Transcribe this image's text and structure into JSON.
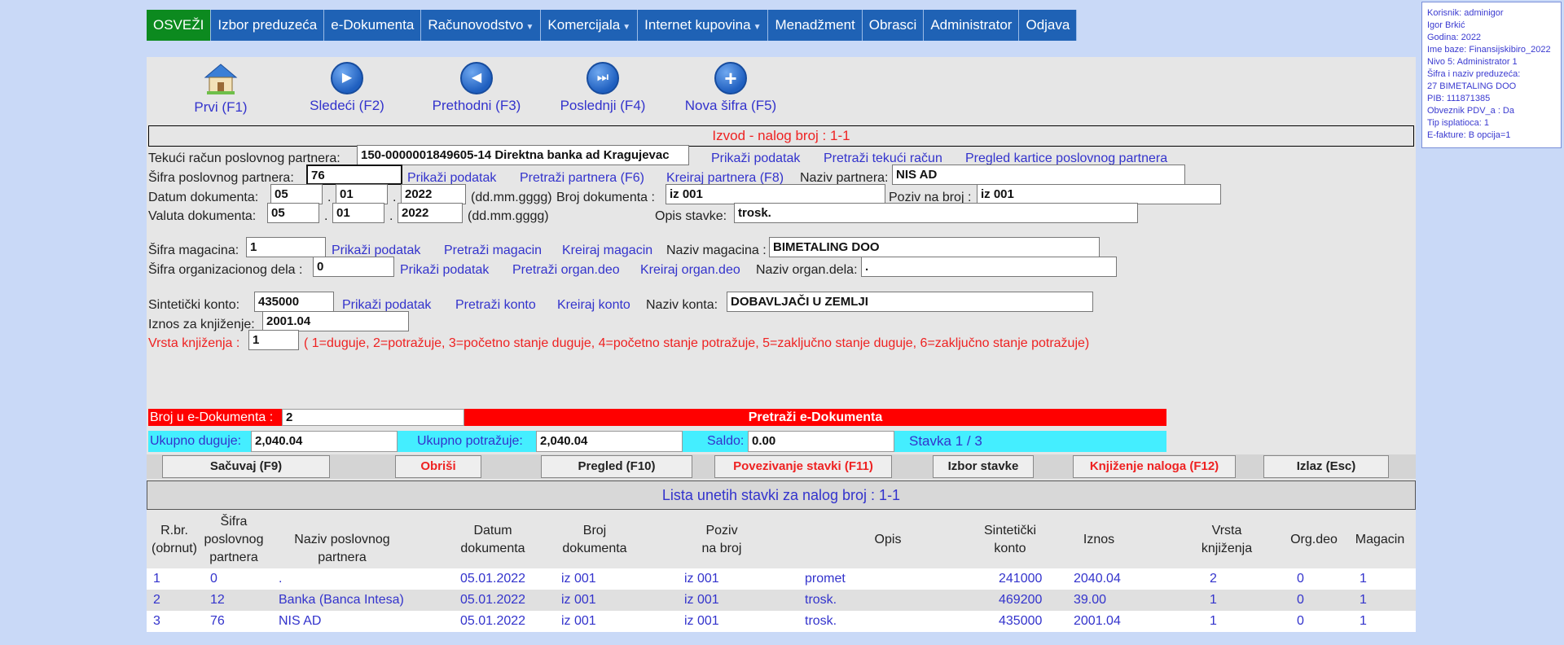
{
  "nav": {
    "items": [
      "OSVEŽI",
      "Izbor preduzeća",
      "e-Dokumenta",
      "Računovodstvo",
      "Komercijala",
      "Internet kupovina",
      "Menadžment",
      "Obrasci",
      "Administrator",
      "Odjava"
    ]
  },
  "info": {
    "lines": [
      "Korisnik: adminigor",
      "Igor Brkić",
      "Godina: 2022",
      "Ime baze: Finansijskibiro_2022",
      "Nivo 5: Administrator 1",
      "Šifra i naziv preduzeća:",
      "27 BIMETALING DOO",
      "PIB: 111871385",
      "Obveznik PDV_a : Da",
      "Tip isplatioca: 1",
      "E-fakture: B opcija=1"
    ]
  },
  "toolbar": {
    "first": "Prvi (F1)",
    "next": "Sledeći (F2)",
    "prev": "Prethodni (F3)",
    "last": "Poslednji (F4)",
    "new": "Nova šifra (F5)"
  },
  "form": {
    "title": "Izvod - nalog broj : 1-1",
    "tekuci_label": "Tekući račun poslovnog partnera:",
    "tekuci_value": "150-0000001849605-14 Direktna banka ad Kragujevac",
    "prikazi": "Prikaži podatak",
    "pretrazi_racun": "Pretraži tekući račun",
    "pregled_kartice": "Pregled kartice poslovnog partnera",
    "sifra_partnera_label": "Šifra poslovnog partnera:",
    "sifra_partnera_value": "76",
    "pretrazi_partnera": "Pretraži partnera (F6)",
    "kreiraj_partnera": "Kreiraj partnera (F8)",
    "naziv_partnera_label": "Naziv partnera:",
    "naziv_partnera_value": "NIS AD",
    "datum_label": "Datum dokumenta:",
    "datum_d": "05",
    "datum_m": "01",
    "datum_y": "2022",
    "dot": ".",
    "format": "(dd.mm.gggg)",
    "broj_label": "Broj dokumenta :",
    "broj_value": "iz 001",
    "poziv_label": "Poziv na broj :",
    "poziv_value": "iz 001",
    "valuta_label": "Valuta dokumenta:",
    "valuta_d": "05",
    "valuta_m": "01",
    "valuta_y": "2022",
    "opis_label": "Opis stavke:",
    "opis_value": "trosk.",
    "magacin_label": "Šifra magacina:",
    "magacin_value": "1",
    "pretrazi_magacin": "Pretraži magacin",
    "kreiraj_magacin": "Kreiraj magacin",
    "naziv_magacina_label": "Naziv magacina :",
    "naziv_magacina_value": "BIMETALING DOO",
    "org_label": "Šifra organizacionog dela :",
    "org_value": "0",
    "pretrazi_org": "Pretraži organ.deo",
    "kreiraj_org": "Kreiraj organ.deo",
    "naziv_org_label": "Naziv organ.dela:",
    "naziv_org_value": ".",
    "konto_label": "Sintetički konto:",
    "konto_value": "435000",
    "pretrazi_konto": "Pretraži konto",
    "kreiraj_konto": "Kreiraj konto",
    "naziv_konta_label": "Naziv konta:",
    "naziv_konta_value": "DOBAVLJAČI U ZEMLJI",
    "iznos_label": "Iznos za knjiženje:",
    "iznos_value": "2001.04",
    "vrsta_label": "Vrsta knjiženja :",
    "vrsta_value": "1",
    "vrsta_help": "( 1=duguje, 2=potražuje, 3=početno stanje duguje, 4=početno stanje potražuje, 5=zaključno stanje duguje, 6=zaključno stanje potražuje)"
  },
  "edok": {
    "broj_label": "Broj u e-Dokumenta :",
    "broj_value": "2",
    "search": "Pretraži e-Dokumenta"
  },
  "totals": {
    "duguje_label": "Ukupno duguje:",
    "duguje_value": "2,040.04",
    "potrazuje_label": "Ukupno potražuje:",
    "potrazuje_value": "2,040.04",
    "saldo_label": "Saldo:",
    "saldo_value": "0.00",
    "stavka": "Stavka 1 / 3"
  },
  "buttons": {
    "save": "Sačuvaj (F9)",
    "delete": "Obriši",
    "review": "Pregled (F10)",
    "link": "Povezivanje stavki (F11)",
    "select": "Izbor stavke",
    "post": "Knjiženje naloga (F12)",
    "exit": "Izlaz (Esc)"
  },
  "list": {
    "title": "Lista unetih stavki za nalog broj : 1-1",
    "headers": {
      "rbr": "R.br.\n(obrnut)",
      "sifra": "Šifra\nposlovnog\npartnera",
      "naziv": "Naziv poslovnog partnera",
      "datum": "Datum\ndokumenta",
      "broj": "Broj\ndokumenta",
      "poziv": "Poziv\nna broj",
      "opis": "Opis",
      "konto": "Sintetički\nkonto",
      "iznos": "Iznos",
      "vrsta": "Vrsta\nknjiženja",
      "org": "Org.deo",
      "magacin": "Magacin"
    },
    "rows": [
      {
        "rbr": "1",
        "sifra": "0",
        "naziv": ".",
        "datum": "05.01.2022",
        "broj": "iz 001",
        "poziv": "iz 001",
        "opis": "promet",
        "konto": "241000",
        "iznos": "2040.04",
        "vrsta": "2",
        "org": "0",
        "magacin": "1"
      },
      {
        "rbr": "2",
        "sifra": "12",
        "naziv": "Banka (Banca Intesa)",
        "datum": "05.01.2022",
        "broj": "iz 001",
        "poziv": "iz 001",
        "opis": "trosk.",
        "konto": "469200",
        "iznos": "39.00",
        "vrsta": "1",
        "org": "0",
        "magacin": "1"
      },
      {
        "rbr": "3",
        "sifra": "76",
        "naziv": "NIS AD",
        "datum": "05.01.2022",
        "broj": "iz 001",
        "poziv": "iz 001",
        "opis": "trosk.",
        "konto": "435000",
        "iznos": "2001.04",
        "vrsta": "1",
        "org": "0",
        "magacin": "1"
      }
    ]
  },
  "colors": {
    "nav_bg": "#1f62b5",
    "nav_active": "#0c8a1f",
    "link": "#3333cc",
    "red_bar": "#ff0000",
    "cyan_bar": "#44eeff"
  }
}
